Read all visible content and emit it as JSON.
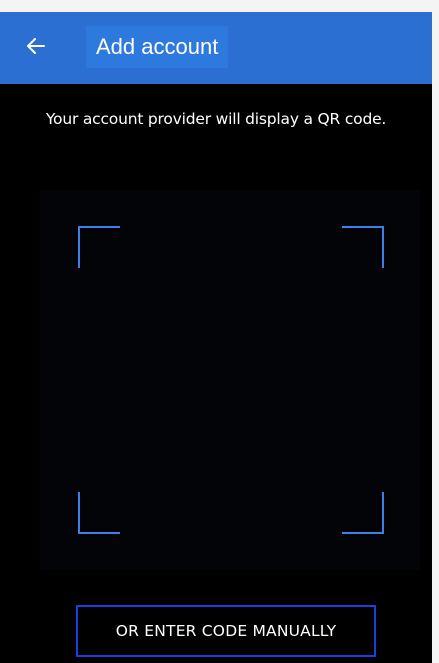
{
  "header": {
    "title": "Add account",
    "back_icon": "arrow-left-icon"
  },
  "main": {
    "instruction": "Your account provider will display a QR code.",
    "manual_entry_label": "OR ENTER CODE MANUALLY"
  },
  "colors": {
    "appbar": "#2b6fd3",
    "accent": "#3f7fe6",
    "button_border": "#1e3fe0",
    "background": "#000000"
  }
}
